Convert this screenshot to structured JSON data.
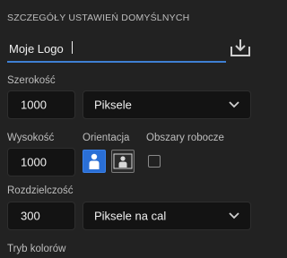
{
  "section_title": "SZCZEGÓŁY USTAWIEŃ DOMYŚLNYCH",
  "preset_name": "Moje Logo",
  "icons": {
    "save_preset": "save-preset-icon",
    "dropdown": "chevron-down-icon",
    "portrait": "portrait-person-icon",
    "landscape": "landscape-person-icon"
  },
  "width": {
    "label": "Szerokość",
    "value": "1000",
    "unit": "Piksele"
  },
  "height": {
    "label": "Wysokość",
    "value": "1000"
  },
  "orientation": {
    "label": "Orientacja",
    "selected": "portrait"
  },
  "artboards": {
    "label": "Obszary robocze",
    "checked": false
  },
  "resolution": {
    "label": "Rozdzielczość",
    "value": "300",
    "unit": "Piksele na cal"
  },
  "color_mode": {
    "label": "Tryb kolorów"
  },
  "colors": {
    "accent": "#2a6fd6",
    "underline": "#3f7fd3",
    "background": "#222222",
    "field": "#131313"
  }
}
